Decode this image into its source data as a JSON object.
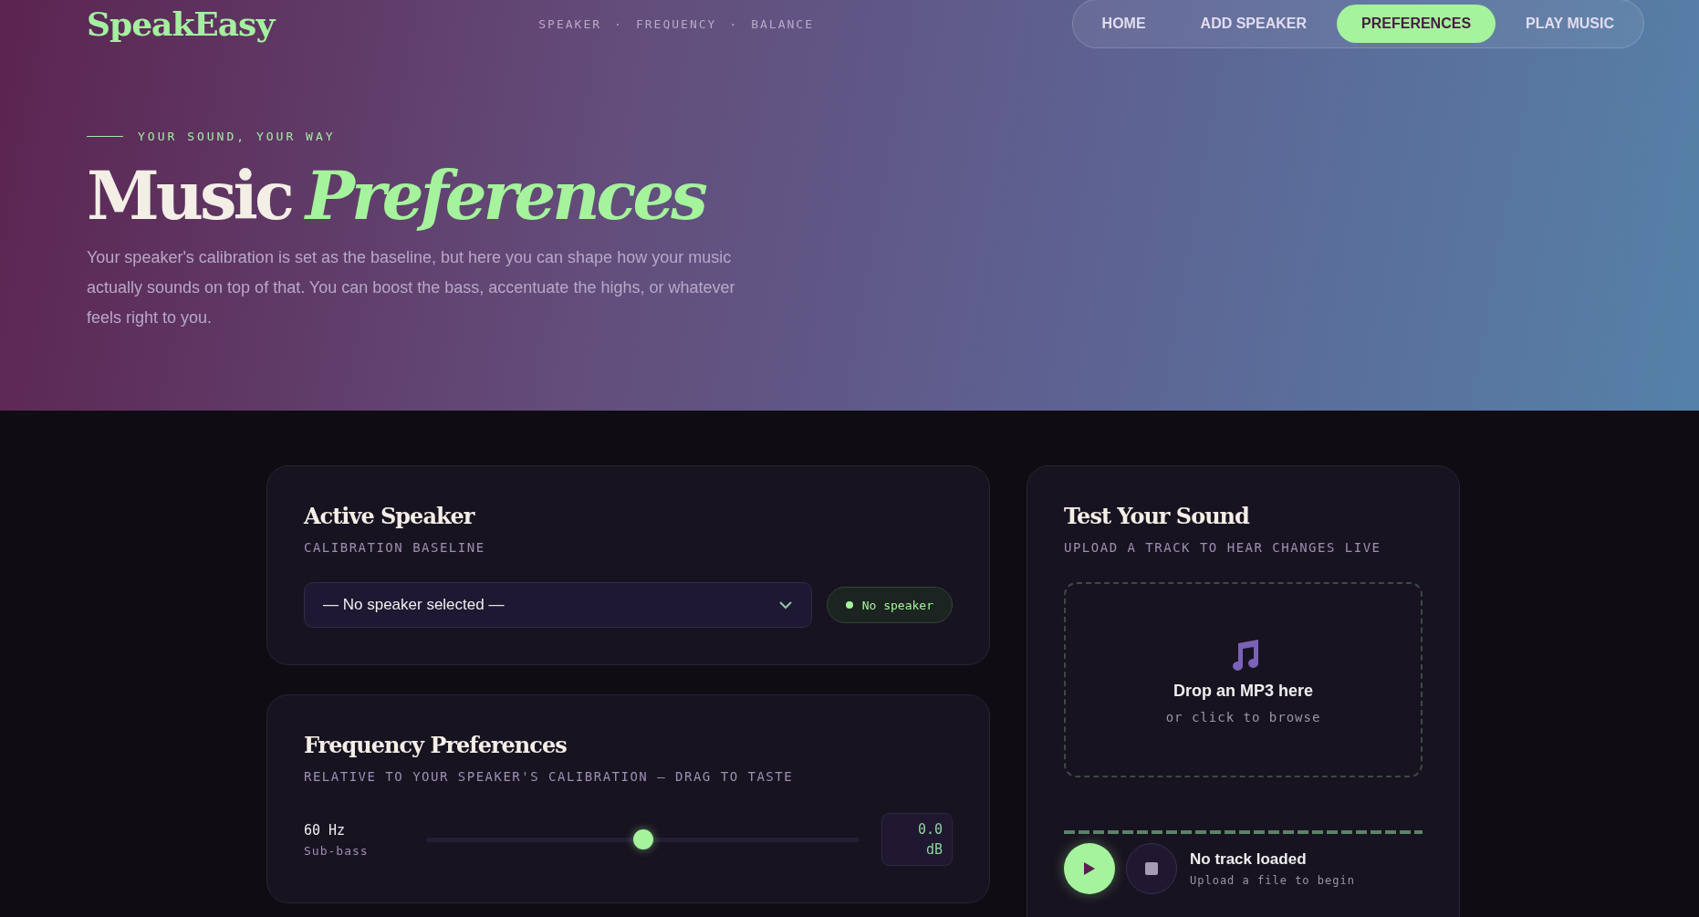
{
  "header": {
    "logo": "SpeakEasy",
    "tagline": [
      "SPEAKER",
      "·",
      "FREQUENCY",
      "·",
      "BALANCE"
    ],
    "nav": [
      {
        "label": "HOME",
        "selected": false
      },
      {
        "label": "ADD SPEAKER",
        "selected": false
      },
      {
        "label": "PREFERENCES",
        "selected": true
      },
      {
        "label": "PLAY MUSIC",
        "selected": false
      }
    ]
  },
  "hero": {
    "eyebrow": "YOUR SOUND, YOUR WAY",
    "title": "Music",
    "title_accent": "Preferences",
    "description": "Your speaker's calibration is set as the baseline, but here you can shape how your music actually sounds on top of that. You can boost the bass, accentuate the highs, or whatever feels right to you."
  },
  "active_speaker": {
    "title": "Active Speaker",
    "subtitle": "CALIBRATION BASELINE",
    "select": {
      "value": "— No speaker selected —"
    },
    "status": "No speaker"
  },
  "frequency": {
    "title": "Frequency Preferences",
    "subtitle": "RELATIVE TO YOUR SPEAKER'S CALIBRATION — DRAG TO TASTE",
    "bands": [
      {
        "label": "60 Hz",
        "sublabel": "Sub-bass",
        "level": 0.5,
        "reading": "0.0",
        "unit": "dB"
      }
    ]
  },
  "test_sound": {
    "title": "Test Your Sound",
    "subtitle": "UPLOAD A TRACK TO HEAR CHANGES LIVE",
    "dropzone": {
      "title": "Drop an MP3 here",
      "hint": "or click to browse"
    },
    "player": {
      "track": "No track loaded",
      "hint": "Upload a file to begin"
    }
  }
}
